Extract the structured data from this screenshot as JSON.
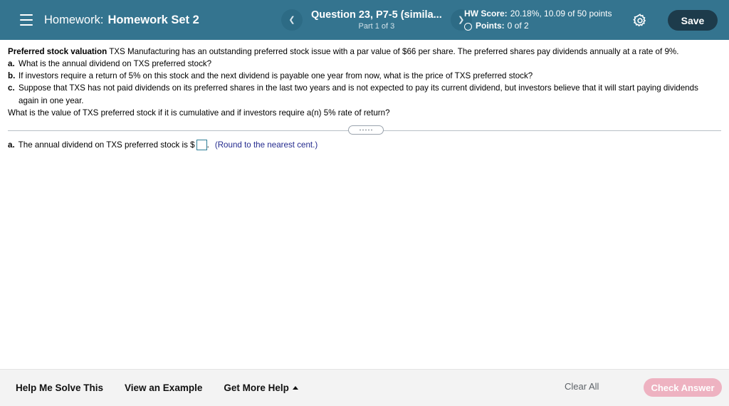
{
  "header": {
    "menu_icon": "hamburger-icon",
    "course_label": "Homework:",
    "assignment_title": "Homework Set 2",
    "prev_icon": "chevron-left-icon",
    "next_icon": "chevron-right-icon",
    "question_title": "Question 23, P7-5 (simila...",
    "question_part": "Part 1 of 3",
    "hw_score_label": "HW Score:",
    "hw_score_value": "20.18%, 10.09 of 50 points",
    "points_label": "Points:",
    "points_value": "0 of 2",
    "settings_icon": "gear-icon",
    "save_label": "Save",
    "bg_color": "#34748f",
    "save_bg_color": "#1d3b4b"
  },
  "question": {
    "lead_in": "Preferred stock valuation",
    "intro": " TXS Manufacturing has an outstanding preferred stock issue with a par value of $66 per share. The preferred shares pay dividends annually at a rate of 9%.",
    "parts": [
      {
        "label": "a.",
        "text": "What is the annual dividend on TXS preferred stock?"
      },
      {
        "label": "b.",
        "text": "If investors require a return of 5% on this stock and the next dividend is payable one year from now, what is the price of TXS preferred stock?"
      },
      {
        "label": "c.",
        "text": "Suppose that TXS has not paid dividends on its preferred shares in the last two years and is not expected to pay its current dividend, but investors believe that it will start paying dividends again in one year."
      }
    ],
    "trailing_line": "What is the value of TXS preferred stock if it is cumulative and if investors require a(n) 5% rate of return?"
  },
  "answer": {
    "part_label": "a.",
    "prompt": "The annual dividend on TXS preferred stock is $",
    "input_value": "",
    "input_placeholder": "",
    "period": ".",
    "rounding_hint": "(Round to the nearest cent.)",
    "hint_color": "#232a8e",
    "input_border_color": "#2e7e96",
    "resize_handle_icon": "drag-handle-icon"
  },
  "footer": {
    "help_me_solve_this": "Help Me Solve This",
    "view_an_example": "View an Example",
    "get_more_help": "Get More Help",
    "get_more_help_caret_icon": "caret-up-icon",
    "clear_all": "Clear All",
    "check_answer": "Check Answer",
    "check_answer_bg_color": "#eeadbd",
    "bg_color": "#f3f3f3"
  }
}
